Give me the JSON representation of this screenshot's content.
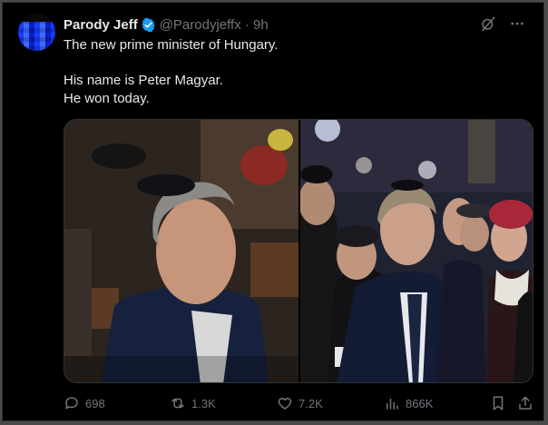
{
  "post": {
    "author_name": "Parody Jeff",
    "handle_time": "@Parodyjeffx · 9h",
    "text_line1": "The new prime minister of Hungary.",
    "text_line2": "His name is Peter Magyar.",
    "text_line3": "He won today."
  },
  "actions": {
    "replies": "698",
    "reposts": "1.3K",
    "likes": "7.2K",
    "views": "866K"
  },
  "colors": {
    "background": "#000000",
    "text": "#e7e9ea",
    "muted": "#71767b",
    "verified": "#1d9bf0"
  },
  "icons": [
    "verified-badge-icon",
    "grok-icon",
    "more-icon",
    "reply-icon",
    "repost-icon",
    "like-icon",
    "views-icon",
    "bookmark-icon",
    "share-icon"
  ]
}
